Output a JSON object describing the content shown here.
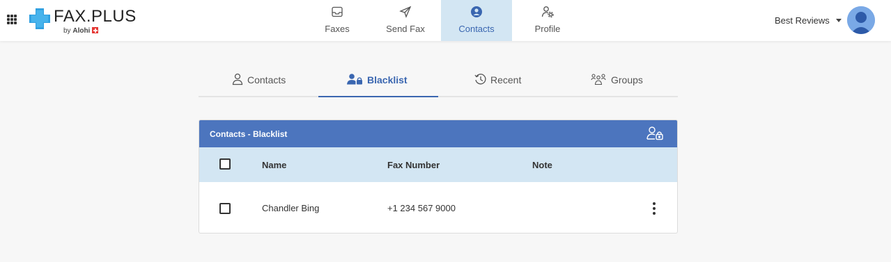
{
  "brand": {
    "title": "FAX.PLUS",
    "sub_prefix": "by ",
    "sub_name": "Alohi"
  },
  "topnav": [
    {
      "label": "Faxes",
      "icon": "inbox-icon"
    },
    {
      "label": "Send Fax",
      "icon": "paper-plane-icon"
    },
    {
      "label": "Contacts",
      "icon": "contact-circle-icon",
      "active": true
    },
    {
      "label": "Profile",
      "icon": "profile-settings-icon"
    }
  ],
  "user": {
    "name": "Best Reviews"
  },
  "subtabs": [
    {
      "label": "Contacts",
      "icon": "person-outline-icon"
    },
    {
      "label": "Blacklist",
      "icon": "person-lock-icon",
      "active": true
    },
    {
      "label": "Recent",
      "icon": "history-icon"
    },
    {
      "label": "Groups",
      "icon": "group-icon"
    }
  ],
  "card": {
    "title": "Contacts - Blacklist",
    "action_icon": "add-to-blacklist-icon",
    "columns": {
      "name": "Name",
      "fax": "Fax Number",
      "note": "Note"
    },
    "rows": [
      {
        "name": "Chandler Bing",
        "fax": "+1 234 567 9000",
        "note": ""
      }
    ]
  },
  "colors": {
    "accent": "#3a66b0",
    "header_blue": "#4c75be",
    "active_bg": "#d3e6f3",
    "logo_blue": "#2f9fe0"
  }
}
